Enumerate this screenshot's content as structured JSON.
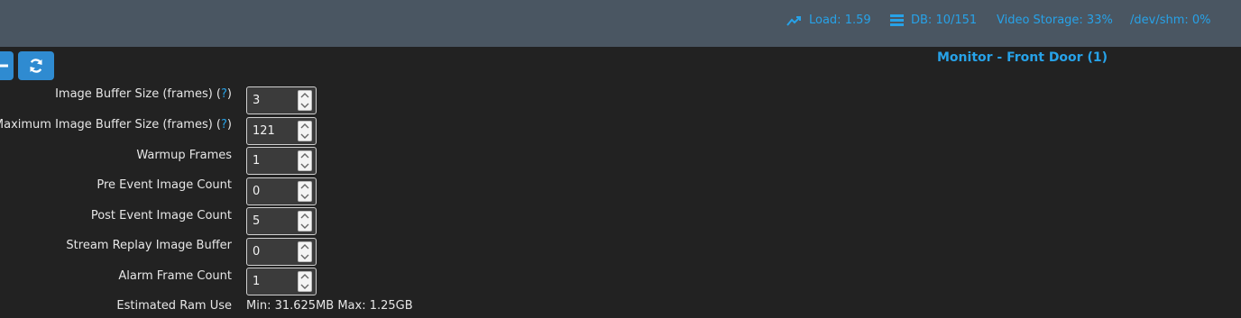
{
  "header": {
    "load": "Load: 1.59",
    "db": "DB: 10/151",
    "video_storage": "Video Storage: 33%",
    "shm": "/dev/shm: 0%"
  },
  "monitor_title": "Monitor - Front Door (1)",
  "help_mark": "?",
  "fields": [
    {
      "label": "Image Buffer Size (frames) (",
      "value": "3",
      "has_help": true
    },
    {
      "label": "Maximum Image Buffer Size (frames) (",
      "value": "121",
      "has_help": true
    },
    {
      "label": "Warmup Frames",
      "value": "1"
    },
    {
      "label": "Pre Event Image Count",
      "value": "0"
    },
    {
      "label": "Post Event Image Count",
      "value": "5"
    },
    {
      "label": "Stream Replay Image Buffer",
      "value": "0"
    },
    {
      "label": "Alarm Frame Count",
      "value": "1"
    }
  ],
  "estimated_ram": {
    "label": "Estimated Ram Use",
    "value": "Min: 31.625MB Max: 1.25GB"
  },
  "icons": {
    "load": "trending-up-icon",
    "db": "database-icon",
    "back": "arrow-left-icon",
    "refresh": "refresh-icon"
  },
  "colors": {
    "accent": "#27a2e8",
    "header_bg": "#4a5662",
    "page_bg": "#222222",
    "button_bg": "#2f8bd1"
  }
}
